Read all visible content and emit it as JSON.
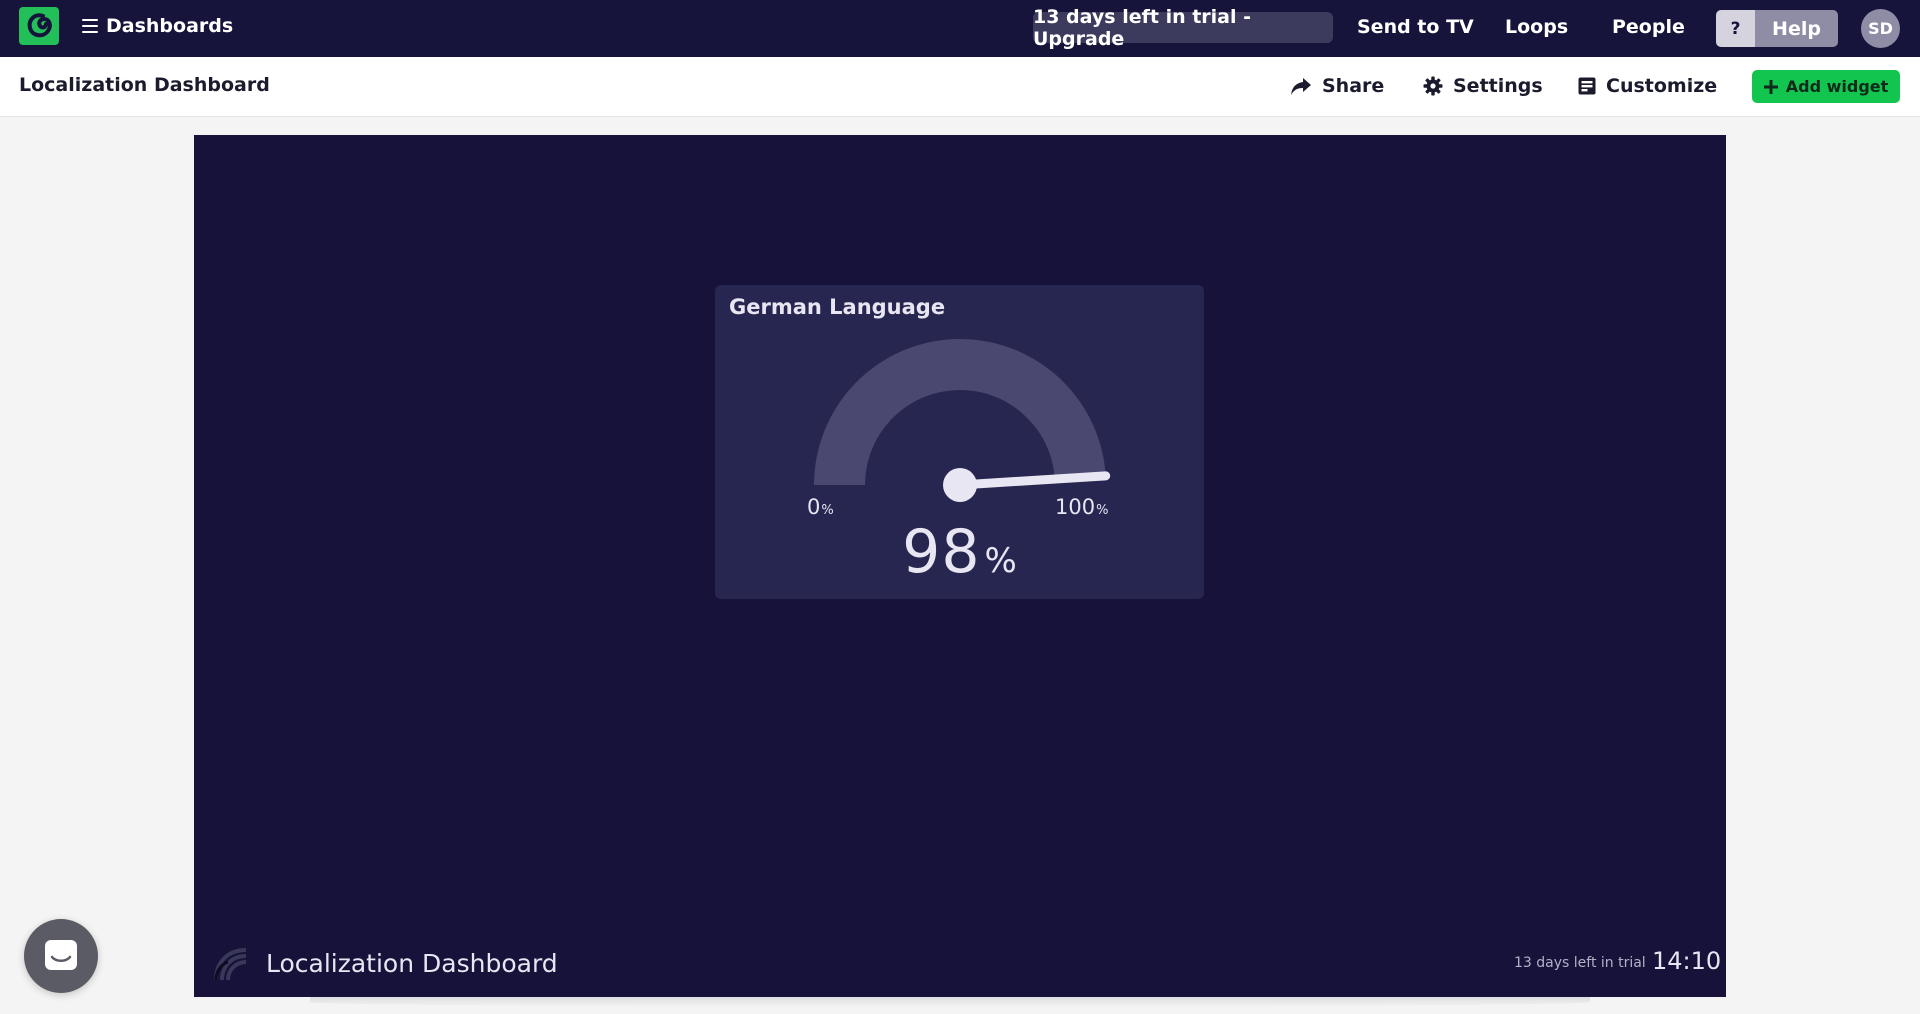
{
  "nav": {
    "menu_label": "Dashboards",
    "trial_label": "13 days left in trial - Upgrade",
    "send_to_tv": "Send to TV",
    "loops": "Loops",
    "people": "People",
    "help_q": "?",
    "help": "Help",
    "avatar": "SD"
  },
  "subheader": {
    "dashboard_name": "Localization Dashboard",
    "share": "Share",
    "settings": "Settings",
    "customize": "Customize",
    "add_widget": "Add widget"
  },
  "widget": {
    "title": "German Language",
    "min_value": "0",
    "max_value": "100",
    "unit": "%",
    "value": "98",
    "value_fraction": 0.98
  },
  "canvas_footer": {
    "title": "Localization Dashboard",
    "trial_text": "13 days left in trial",
    "time": "14:10"
  },
  "colors": {
    "nav_bg": "#16143a",
    "canvas_bg": "#16123a",
    "widget_bg": "#272650",
    "accent_green": "#12c54f",
    "gauge_track": "#4a4870",
    "gauge_needle": "#e7e6f2"
  }
}
